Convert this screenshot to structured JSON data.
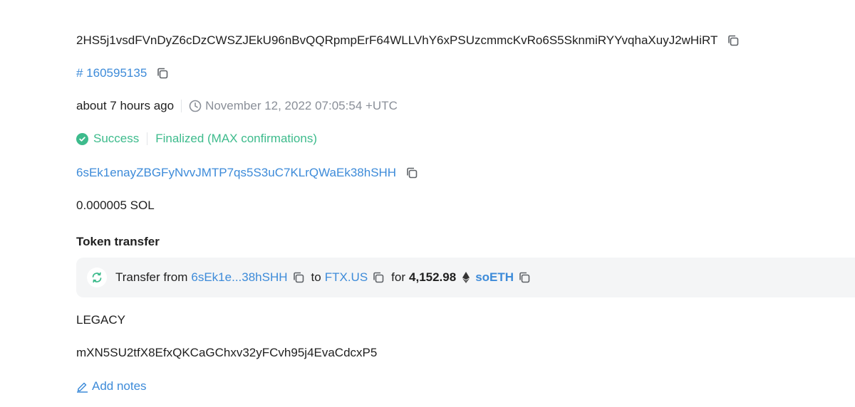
{
  "signature": {
    "value": "2HS5j1vsdFVnDyZ6cDzCWSZJEkU96nBvQQRpmpErF64WLLVhY6xPSUzcmmcKvRo6S5SknmiRYYvqhaXuyJ2wHiRT",
    "copy_icon": "copy-icon"
  },
  "block": {
    "value": "# 160595135",
    "copy_icon": "copy-icon"
  },
  "timestamp": {
    "relative": "about 7 hours ago",
    "absolute": "November 12, 2022 07:05:54 +UTC",
    "icon": "clock-icon"
  },
  "status": {
    "result": "Success",
    "confirmation": "Finalized (MAX confirmations)",
    "icon": "check-circle-icon",
    "color": "#3dbb8c"
  },
  "signer": {
    "value": "6sEk1enayZBGFyNvvJMTP7qs5S3uC7KLrQWaEk38hSHH",
    "copy_icon": "copy-icon"
  },
  "fee": {
    "value": "0.000005 SOL"
  },
  "token_transfer": {
    "title": "Token transfer",
    "icon": "swap-icon",
    "transfer_from_label": "Transfer from",
    "from_address": "6sEk1e...38hSHH",
    "to_label": "to",
    "to_address": "FTX.US",
    "for_label": "for",
    "amount": "4,152.98",
    "token_icon": "ethereum-icon",
    "token": "soETH"
  },
  "version": {
    "value": "LEGACY"
  },
  "recent_blockhash": {
    "value": "mXN5SU2tfX8EfxQKCaGChxv32yFCvh95j4EvaCdcxP5"
  },
  "notes": {
    "label": "Add notes",
    "icon": "pencil-icon"
  },
  "colors": {
    "link": "#3d8bd9",
    "muted": "#8a8f98",
    "success": "#3dbb8c",
    "panel": "#f4f5f6"
  }
}
